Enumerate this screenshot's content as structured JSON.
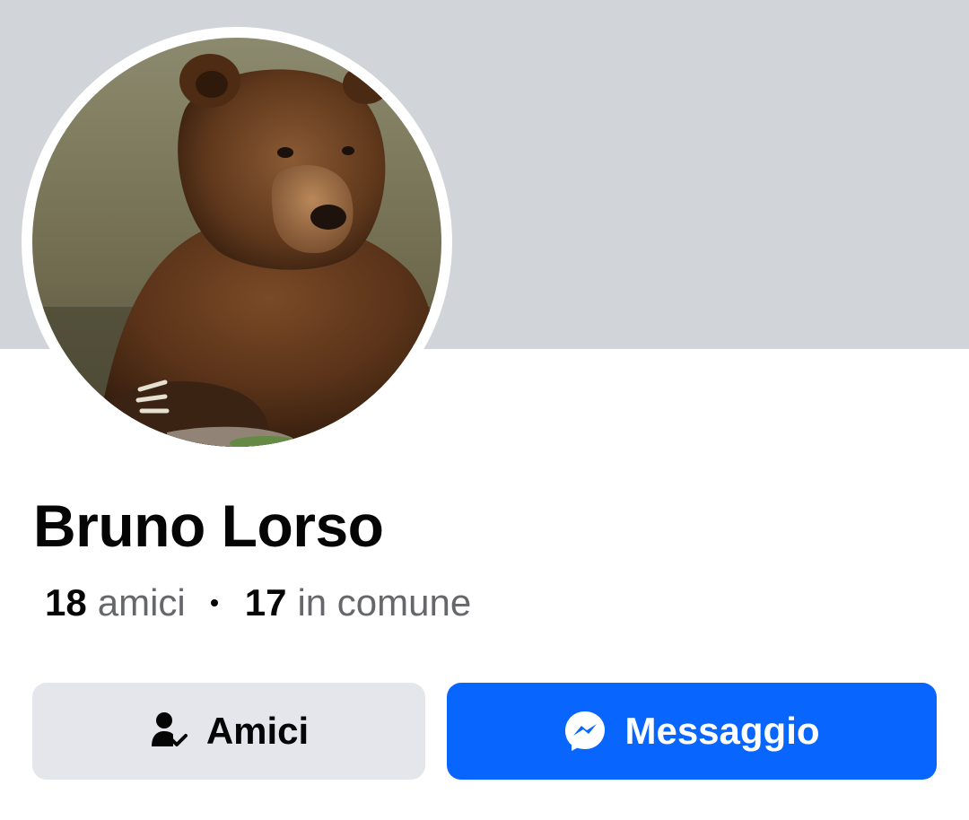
{
  "profile": {
    "name": "Bruno Lorso",
    "avatar_alt": "bear-photo",
    "stats": {
      "friends_count": "18",
      "friends_label": "amici",
      "mutual_count": "17",
      "mutual_label": "in comune"
    }
  },
  "actions": {
    "friends_button": {
      "label": "Amici",
      "icon": "friend-check-icon"
    },
    "message_button": {
      "label": "Messaggio",
      "icon": "messenger-icon"
    }
  },
  "colors": {
    "cover": "#d1d4d9",
    "primary": "#0866ff",
    "secondary_button": "#e4e6eb",
    "text_primary": "#050505",
    "text_secondary": "#65676b"
  }
}
